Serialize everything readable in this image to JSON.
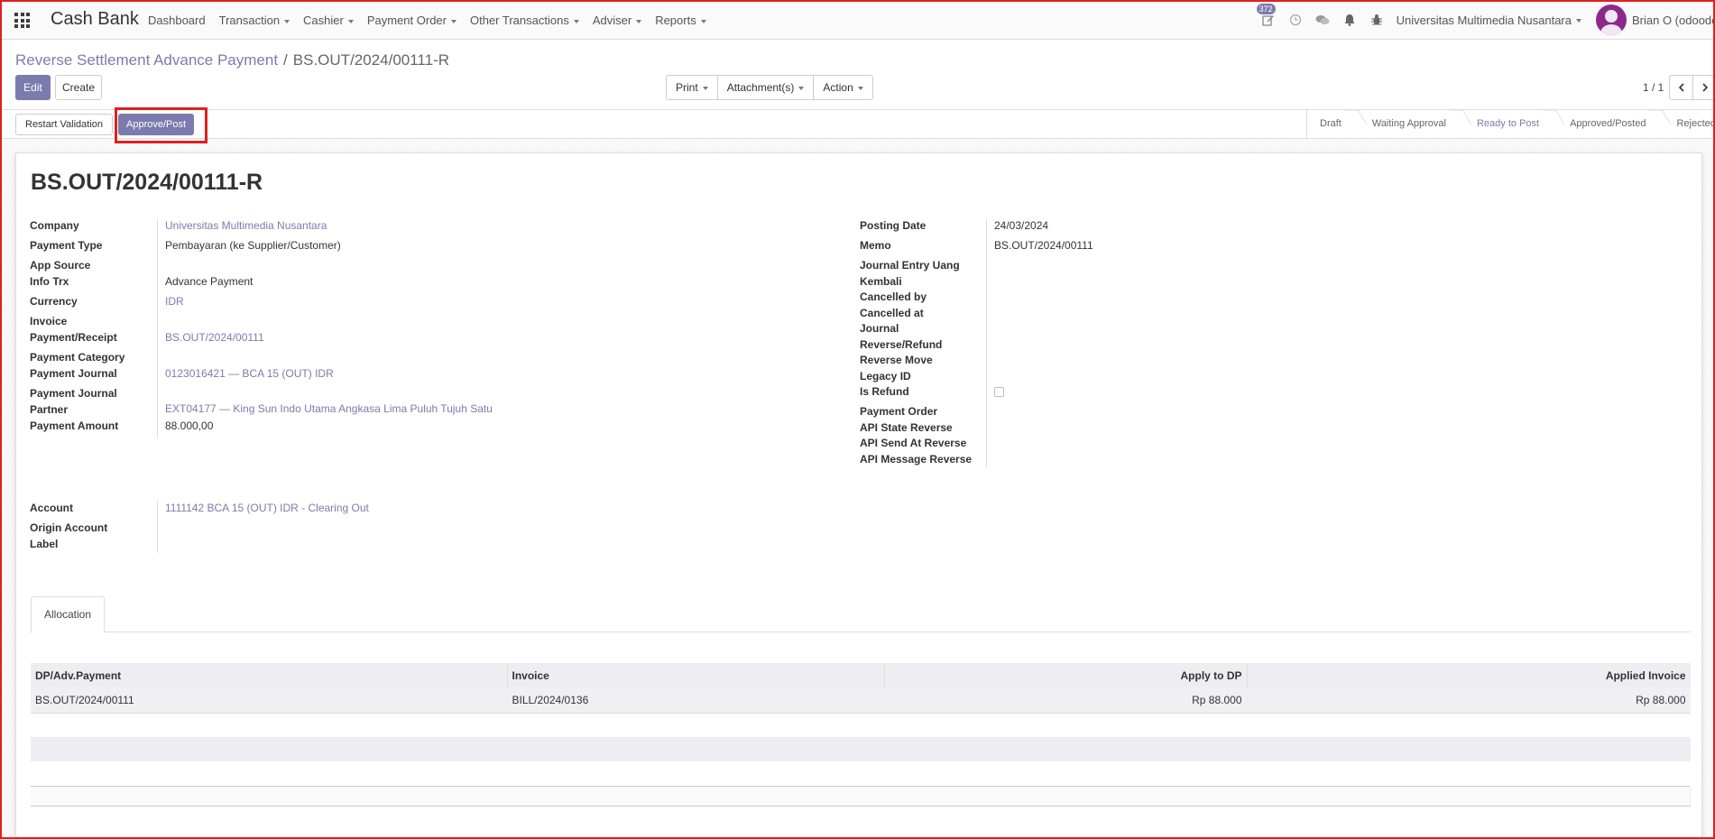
{
  "nav": {
    "brand": "Cash Bank",
    "menu": [
      "Dashboard",
      "Transaction",
      "Cashier",
      "Payment Order",
      "Other Transactions",
      "Adviser",
      "Reports"
    ],
    "activity_count": "372",
    "company": "Universitas Multimedia Nusantara",
    "user": "Brian O (odoodev"
  },
  "breadcrumb": {
    "parent": "Reverse Settlement Advance Payment",
    "separator": "/",
    "current": "BS.OUT/2024/00111-R"
  },
  "control": {
    "edit": "Edit",
    "create": "Create",
    "print": "Print",
    "attachments": "Attachment(s)",
    "action": "Action",
    "pager": "1 / 1"
  },
  "status": {
    "restart": "Restart Validation",
    "approve": "Approve/Post",
    "stages": [
      "Draft",
      "Waiting Approval",
      "Ready to Post",
      "Approved/Posted",
      "Rejected"
    ],
    "active_stage": "Ready to Post"
  },
  "record": {
    "title": "BS.OUT/2024/00111-R",
    "left": {
      "company_label": "Company",
      "company": "Universitas Multimedia Nusantara",
      "payment_type_label": "Payment Type",
      "payment_type": "Pembayaran (ke Supplier/Customer)",
      "app_source_label": "App Source",
      "info_trx_label": "Info Trx",
      "info_trx": "Advance Payment",
      "currency_label": "Currency",
      "currency": "IDR",
      "invoice_label": "Invoice",
      "payment_receipt_label": "Payment/Receipt",
      "payment_receipt": "BS.OUT/2024/00111",
      "payment_category_label": "Payment Category",
      "payment_journal_label": "Payment Journal",
      "payment_journal": "0123016421 — BCA 15 (OUT) IDR",
      "payment_journal_partner_label_1": "Payment Journal",
      "partner_label": "Partner",
      "partner": "EXT04177 — King Sun Indo Utama Angkasa Lima Puluh Tujuh Satu",
      "payment_amount_label": "Payment Amount",
      "payment_amount": "88.000,00",
      "account_label": "Account",
      "account": "1111142 BCA 15 (OUT) IDR - Clearing Out",
      "origin_account_label_1": "Origin Account",
      "origin_account_label_2": "Label"
    },
    "right": {
      "posting_date_label": "Posting Date",
      "posting_date": "24/03/2024",
      "memo_label": "Memo",
      "memo": "BS.OUT/2024/00111",
      "je_label_1": "Journal Entry Uang",
      "je_label_2": "Kembali",
      "cancelled_by_label": "Cancelled by",
      "cancelled_at_label": "Cancelled at",
      "journal_label": "Journal",
      "reverse_refund_label": "Reverse/Refund",
      "reverse_move_label": "Reverse Move",
      "legacy_id_label": "Legacy ID",
      "is_refund_label": "Is Refund",
      "payment_order_label": "Payment Order",
      "api_state_label": "API State Reverse",
      "api_send_label": "API Send At Reverse",
      "api_message_label": "API Message Reverse"
    }
  },
  "notebook": {
    "tab": "Allocation",
    "columns": [
      "DP/Adv.Payment",
      "Invoice",
      "Apply to DP",
      "Applied Invoice"
    ],
    "rows": [
      {
        "dp": "BS.OUT/2024/00111",
        "invoice": "BILL/2024/0136",
        "apply": "Rp 88.000",
        "applied": "Rp 88.000"
      }
    ]
  }
}
